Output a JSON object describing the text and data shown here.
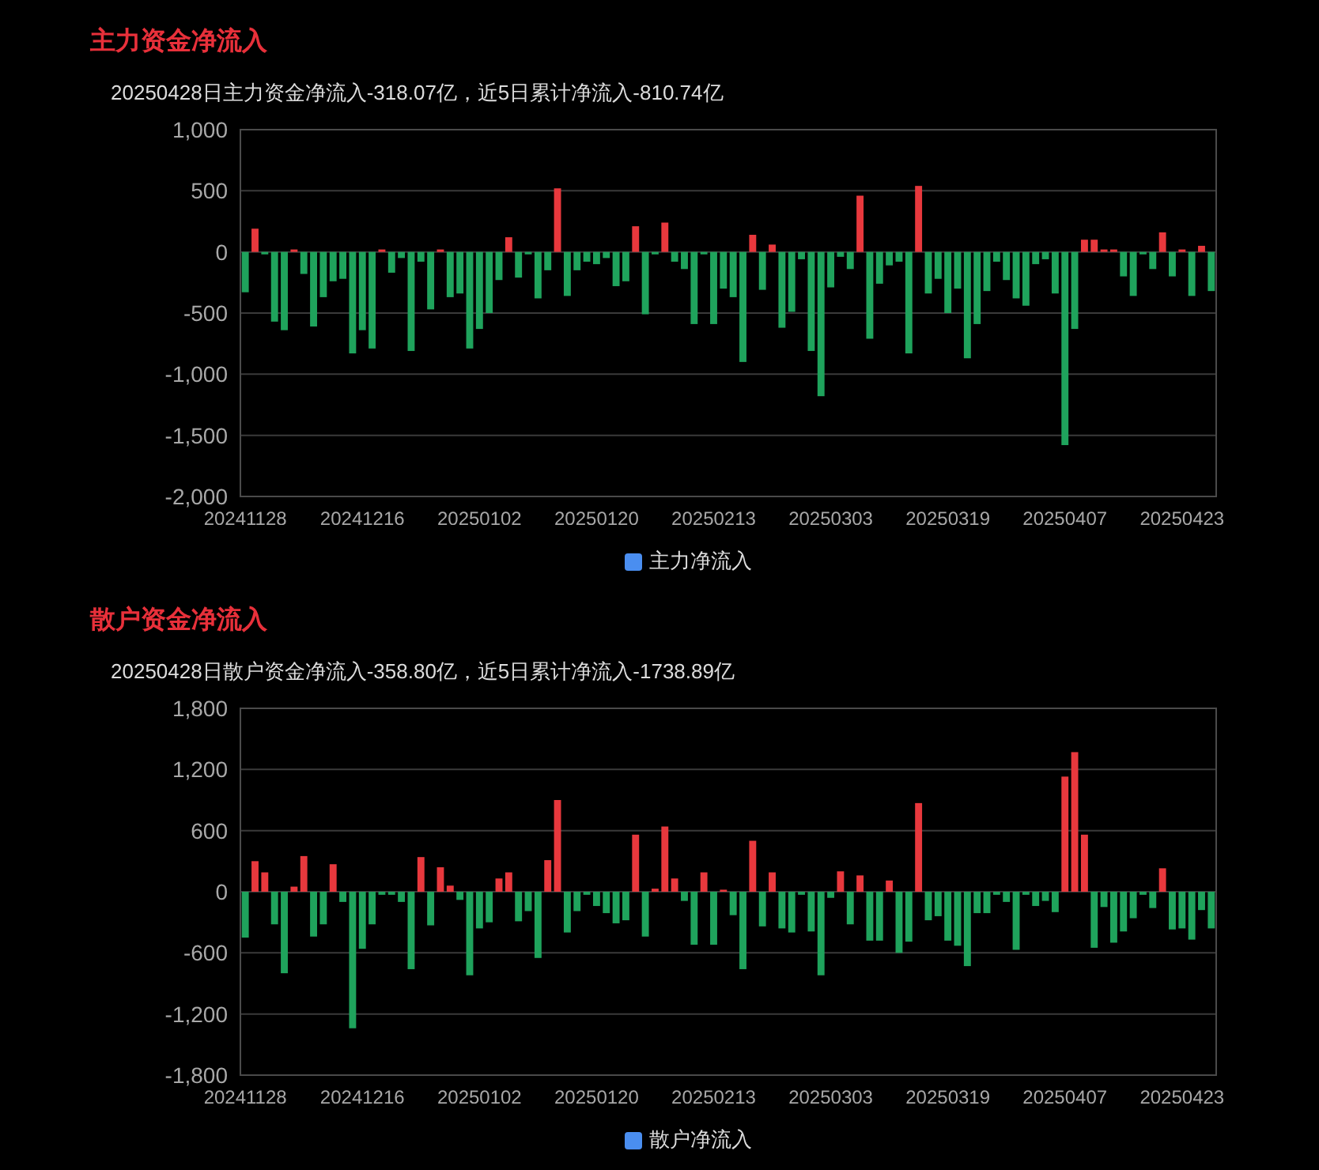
{
  "sections": [
    {
      "title": "主力资金净流入",
      "summary": "20250428日主力资金净流入-318.07亿，近5日累计净流入-810.74亿",
      "chart_data": {
        "type": "bar",
        "grid": true,
        "ylim": [
          -2000,
          1000
        ],
        "categories": [
          "20241128",
          null,
          null,
          null,
          null,
          null,
          null,
          null,
          null,
          null,
          null,
          null,
          "20241216",
          null,
          null,
          null,
          null,
          null,
          null,
          null,
          null,
          null,
          null,
          null,
          "20250102",
          null,
          null,
          null,
          null,
          null,
          null,
          null,
          null,
          null,
          null,
          null,
          "20250120",
          null,
          null,
          null,
          null,
          null,
          null,
          null,
          null,
          null,
          null,
          null,
          "20250213",
          null,
          null,
          null,
          null,
          null,
          null,
          null,
          null,
          null,
          null,
          null,
          "20250303",
          null,
          null,
          null,
          null,
          null,
          null,
          null,
          null,
          null,
          null,
          null,
          "20250319",
          null,
          null,
          null,
          null,
          null,
          null,
          null,
          null,
          null,
          null,
          null,
          "20250407",
          null,
          null,
          null,
          null,
          null,
          null,
          null,
          null,
          null,
          null,
          null,
          "20250423",
          null,
          null,
          null
        ],
        "yticks": [
          {
            "value": 1000,
            "label": "1,000"
          },
          {
            "value": 500,
            "label": "500"
          },
          {
            "value": 0,
            "label": "0"
          },
          {
            "value": -500,
            "label": "-500"
          },
          {
            "value": -1000,
            "label": "-1,000"
          },
          {
            "value": -1500,
            "label": "-1,500"
          },
          {
            "value": -2000,
            "label": "-2,000"
          }
        ],
        "series": [
          {
            "name": "主力净流入",
            "values": [
              -330,
              190,
              -20,
              -570,
              -640,
              20,
              -180,
              -610,
              -370,
              -240,
              -220,
              -830,
              -640,
              -790,
              20,
              -170,
              -50,
              -810,
              -80,
              -470,
              20,
              -370,
              -340,
              -790,
              -630,
              -500,
              -230,
              120,
              -210,
              -20,
              -380,
              -150,
              520,
              -360,
              -150,
              -80,
              -100,
              -50,
              -280,
              -240,
              210,
              -510,
              -20,
              240,
              -80,
              -140,
              -590,
              -20,
              -590,
              -300,
              -370,
              -900,
              140,
              -310,
              60,
              -620,
              -490,
              -60,
              -810,
              -1180,
              -290,
              -40,
              -140,
              460,
              -710,
              -260,
              -110,
              -80,
              -830,
              540,
              -340,
              -220,
              -500,
              -300,
              -870,
              -590,
              -320,
              -80,
              -230,
              -380,
              -440,
              -100,
              -60,
              -340,
              -1580,
              -630,
              100,
              100,
              20,
              20,
              -200,
              -360,
              -20,
              -140,
              160,
              -200,
              20,
              -360,
              50,
              -320
            ]
          }
        ]
      }
    },
    {
      "title": "散户资金净流入",
      "summary": "20250428日散户资金净流入-358.80亿，近5日累计净流入-1738.89亿",
      "chart_data": {
        "type": "bar",
        "grid": true,
        "ylim": [
          -1800,
          1800
        ],
        "categories": [
          "20241128",
          null,
          null,
          null,
          null,
          null,
          null,
          null,
          null,
          null,
          null,
          null,
          "20241216",
          null,
          null,
          null,
          null,
          null,
          null,
          null,
          null,
          null,
          null,
          null,
          "20250102",
          null,
          null,
          null,
          null,
          null,
          null,
          null,
          null,
          null,
          null,
          null,
          "20250120",
          null,
          null,
          null,
          null,
          null,
          null,
          null,
          null,
          null,
          null,
          null,
          "20250213",
          null,
          null,
          null,
          null,
          null,
          null,
          null,
          null,
          null,
          null,
          null,
          "20250303",
          null,
          null,
          null,
          null,
          null,
          null,
          null,
          null,
          null,
          null,
          null,
          "20250319",
          null,
          null,
          null,
          null,
          null,
          null,
          null,
          null,
          null,
          null,
          null,
          "20250407",
          null,
          null,
          null,
          null,
          null,
          null,
          null,
          null,
          null,
          null,
          null,
          "20250423",
          null,
          null,
          null
        ],
        "yticks": [
          {
            "value": 1800,
            "label": "1,800"
          },
          {
            "value": 1200,
            "label": "1,200"
          },
          {
            "value": 600,
            "label": "600"
          },
          {
            "value": 0,
            "label": "0"
          },
          {
            "value": -600,
            "label": "-600"
          },
          {
            "value": -1200,
            "label": "-1,200"
          },
          {
            "value": -1800,
            "label": "-1,800"
          }
        ],
        "series": [
          {
            "name": "散户净流入",
            "values": [
              -450,
              300,
              190,
              -320,
              -800,
              50,
              350,
              -440,
              -320,
              270,
              -100,
              -1340,
              -560,
              -320,
              -30,
              -30,
              -100,
              -760,
              340,
              -330,
              240,
              60,
              -80,
              -820,
              -360,
              -300,
              130,
              190,
              -290,
              -190,
              -650,
              310,
              900,
              -400,
              -190,
              -30,
              -140,
              -210,
              -310,
              -280,
              560,
              -440,
              30,
              640,
              130,
              -90,
              -520,
              190,
              -520,
              20,
              -230,
              -760,
              500,
              -340,
              190,
              -360,
              -400,
              -30,
              -390,
              -820,
              -60,
              200,
              -320,
              160,
              -480,
              -480,
              110,
              -600,
              -490,
              870,
              -280,
              -240,
              -480,
              -530,
              -730,
              -210,
              -210,
              -30,
              -100,
              -570,
              -30,
              -140,
              -90,
              -200,
              1130,
              1370,
              560,
              -550,
              -150,
              -500,
              -390,
              -260,
              -30,
              -160,
              230,
              -370,
              -360,
              -470,
              -180,
              -360
            ]
          }
        ]
      }
    }
  ]
}
